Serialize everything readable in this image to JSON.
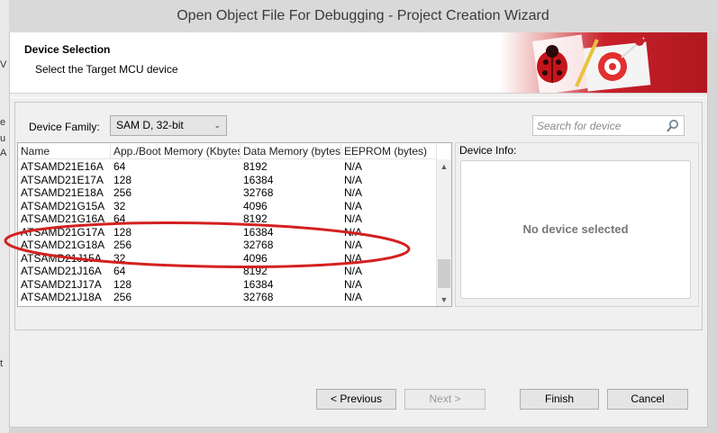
{
  "window": {
    "title": "Open Object File For Debugging  -  Project Creation Wizard"
  },
  "left_strip": {
    "glyphs": [
      "V",
      "e",
      "u",
      "A",
      "t"
    ]
  },
  "header": {
    "title": "Device Selection",
    "subtitle": "Select the Target MCU device"
  },
  "device_family": {
    "label": "Device Family:",
    "selected": "SAM D, 32-bit"
  },
  "search": {
    "placeholder": "Search for device"
  },
  "table": {
    "columns": [
      "Name",
      "App./Boot Memory (Kbytes)",
      "Data Memory (bytes)",
      "EEPROM (bytes)"
    ],
    "rows": [
      [
        "ATSAMD21E16A",
        "64",
        "8192",
        "N/A"
      ],
      [
        "ATSAMD21E17A",
        "128",
        "16384",
        "N/A"
      ],
      [
        "ATSAMD21E18A",
        "256",
        "32768",
        "N/A"
      ],
      [
        "ATSAMD21G15A",
        "32",
        "4096",
        "N/A"
      ],
      [
        "ATSAMD21G16A",
        "64",
        "8192",
        "N/A"
      ],
      [
        "ATSAMD21G17A",
        "128",
        "16384",
        "N/A"
      ],
      [
        "ATSAMD21G18A",
        "256",
        "32768",
        "N/A"
      ],
      [
        "ATSAMD21J15A",
        "32",
        "4096",
        "N/A"
      ],
      [
        "ATSAMD21J16A",
        "64",
        "8192",
        "N/A"
      ],
      [
        "ATSAMD21J17A",
        "128",
        "16384",
        "N/A"
      ],
      [
        "ATSAMD21J18A",
        "256",
        "32768",
        "N/A"
      ]
    ]
  },
  "device_info": {
    "label": "Device Info:",
    "empty_message": "No device selected"
  },
  "buttons": {
    "previous": "< Previous",
    "next": "Next >",
    "finish": "Finish",
    "cancel": "Cancel"
  },
  "colors": {
    "annotation": "#d42020",
    "banner_red": "#c8202a"
  }
}
